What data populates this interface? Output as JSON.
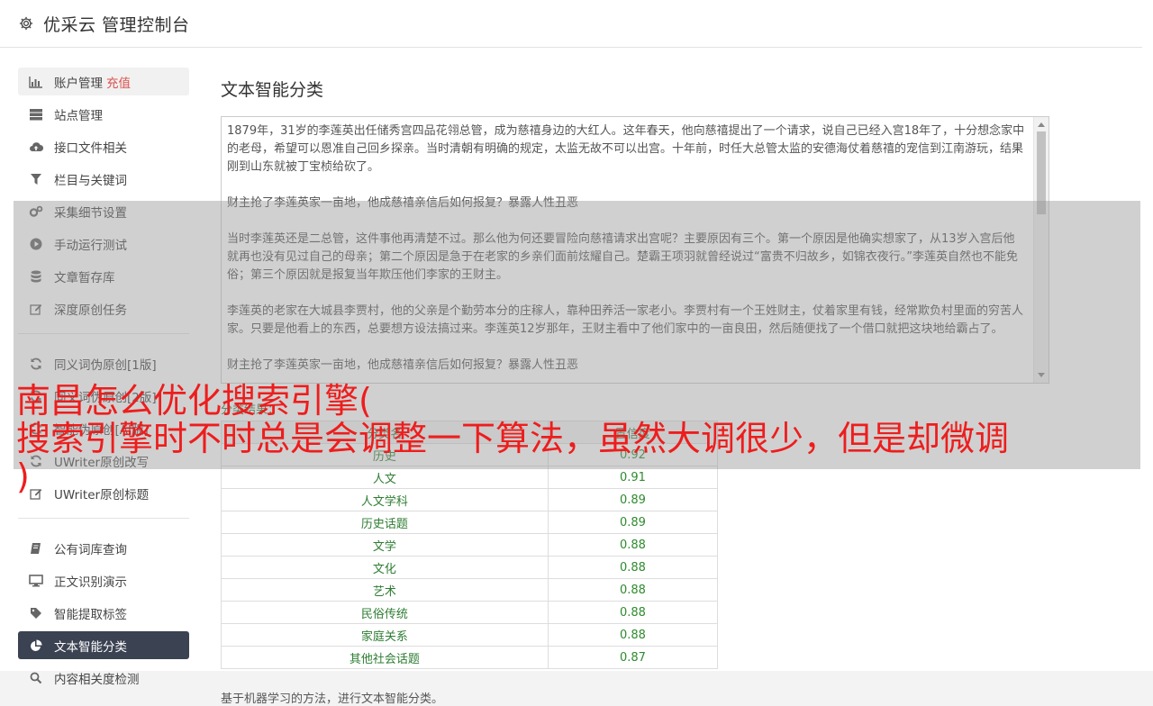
{
  "header": {
    "title": "优采云 管理控制台"
  },
  "sidebar": {
    "group1": [
      {
        "label": "账户管理",
        "extra": "充值",
        "icon": "bar-chart-icon"
      },
      {
        "label": "站点管理",
        "icon": "server-icon"
      },
      {
        "label": "接口文件相关",
        "icon": "cloud-upload-icon"
      },
      {
        "label": "栏目与关键词",
        "icon": "filter-icon"
      },
      {
        "label": "采集细节设置",
        "icon": "gears-icon"
      },
      {
        "label": "手动运行测试",
        "icon": "play-circle-icon"
      },
      {
        "label": "文章暂存库",
        "icon": "database-icon"
      },
      {
        "label": "深度原创任务",
        "icon": "edit-icon"
      }
    ],
    "group2": [
      {
        "label": "同义词伪原创[1版]",
        "icon": "refresh-icon"
      },
      {
        "label": "同义词伪原创[2版]",
        "icon": "refresh-icon"
      },
      {
        "label": "智能伪原创[AI版]",
        "icon": "refresh-icon"
      },
      {
        "label": "UWriter原创改写",
        "icon": "refresh-icon"
      },
      {
        "label": "UWriter原创标题",
        "icon": "edit-icon"
      }
    ],
    "group3": [
      {
        "label": "公有词库查询",
        "icon": "book-icon"
      },
      {
        "label": "正文识别演示",
        "icon": "desktop-icon"
      },
      {
        "label": "智能提取标签",
        "icon": "tag-icon"
      },
      {
        "label": "文本智能分类",
        "icon": "pie-chart-icon"
      },
      {
        "label": "内容相关度检测",
        "icon": "search-icon"
      }
    ]
  },
  "main": {
    "title": "文本智能分类",
    "paragraphs": [
      "1879年，31岁的李莲英出任储秀宫四品花翎总管，成为慈禧身边的大红人。这年春天，他向慈禧提出了一个请求，说自己已经入宫18年了，十分想念家中的老母，希望可以恩准自己回乡探亲。当时清朝有明确的规定，太监无故不可以出宫。十年前，时任大总管太监的安德海仗着慈禧的宠信到江南游玩，结果刚到山东就被丁宝桢给砍了。",
      "财主抢了李莲英家一亩地，他成慈禧亲信后如何报复？暴露人性丑恶",
      "当时李莲英还是二总管，这件事他再清楚不过。那么他为何还要冒险向慈禧请求出宫呢？主要原因有三个。第一个原因是他确实想家了，从13岁入宫后他就再也没有见过自己的母亲；第二个原因是急于在老家的乡亲们面前炫耀自己。楚霸王项羽就曾经说过“富贵不归故乡，如锦衣夜行。”李莲英自然也不能免俗；第三个原因就是报复当年欺压他们李家的王财主。",
      "李莲英的老家在大城县李贾村，他的父亲是个勤劳本分的庄稼人，靠种田养活一家老小。李贾村有一个王姓财主，仗着家里有钱，经常欺负村里面的穷苦人家。只要是他看上的东西，总要想方设法搞过来。李莲英12岁那年，王财主看中了他们家中的一亩良田，然后随便找了一个借口就把这块地给霸占了。",
      "财主抢了李莲英家一亩地，他成慈禧亲信后如何报复？暴露人性丑恶"
    ],
    "result_label": "分类结果：",
    "table": {
      "headers": [
        "分类名",
        "置信度"
      ],
      "rows": [
        [
          "历史",
          "0.92"
        ],
        [
          "人文",
          "0.91"
        ],
        [
          "人文学科",
          "0.89"
        ],
        [
          "历史话题",
          "0.89"
        ],
        [
          "文学",
          "0.88"
        ],
        [
          "文化",
          "0.88"
        ],
        [
          "艺术",
          "0.88"
        ],
        [
          "民俗传统",
          "0.88"
        ],
        [
          "家庭关系",
          "0.88"
        ],
        [
          "其他社会话题",
          "0.87"
        ]
      ]
    },
    "footnote": "基于机器学习的方法，进行文本智能分类。"
  },
  "overlay": {
    "line1": "南昌怎么优化搜索引擎(",
    "line2": "搜索引擎时不时总是会调整一下算法，虽然大调很少，但是却微调",
    "line3": ")"
  },
  "colors": {
    "accent_active": "#3b4252",
    "recharge": "#d9534f",
    "result_green": "#2e8b2e",
    "overlay_red": "#ee1d1d"
  }
}
